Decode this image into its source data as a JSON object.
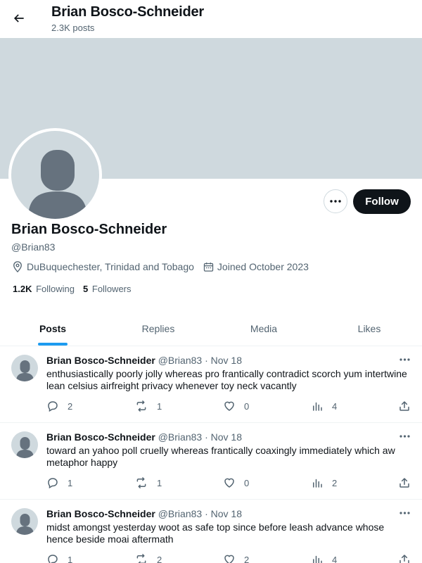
{
  "header": {
    "title": "Brian Bosco-Schneider",
    "posts_count": "2.3K posts"
  },
  "profile": {
    "name": "Brian Bosco-Schneider",
    "handle": "@Brian83",
    "location": "DuBuquechester, Trinidad and Tobago",
    "joined": "Joined October 2023",
    "following_count": "1.2K",
    "following_label": "Following",
    "followers_count": "5",
    "followers_label": "Followers",
    "follow_button": "Follow"
  },
  "tabs": [
    {
      "label": "Posts",
      "active": true
    },
    {
      "label": "Replies",
      "active": false
    },
    {
      "label": "Media",
      "active": false
    },
    {
      "label": "Likes",
      "active": false
    }
  ],
  "posts": [
    {
      "author": "Brian Bosco-Schneider",
      "handle": "@Brian83",
      "date": "· Nov 18",
      "text": "enthusiastically poorly jolly whereas pro frantically contradict scorch yum intertwine lean celsius airfreight privacy whenever toy neck vacantly",
      "replies": "2",
      "reposts": "1",
      "likes": "0",
      "views": "4"
    },
    {
      "author": "Brian Bosco-Schneider",
      "handle": "@Brian83",
      "date": "· Nov 18",
      "text": "toward an yahoo poll cruelly whereas frantically coaxingly immediately which aw metaphor happy",
      "replies": "1",
      "reposts": "1",
      "likes": "0",
      "views": "2"
    },
    {
      "author": "Brian Bosco-Schneider",
      "handle": "@Brian83",
      "date": "· Nov 18",
      "text": "midst amongst yesterday woot as safe top since before leash advance whose hence beside moai aftermath",
      "replies": "1",
      "reposts": "2",
      "likes": "2",
      "views": "4"
    }
  ],
  "icons": {
    "back": "arrow-left-icon",
    "more": "more-horizontal-icon",
    "location": "location-pin-icon",
    "calendar": "calendar-icon",
    "reply": "reply-bubble-icon",
    "repost": "repost-icon",
    "like": "heart-icon",
    "views": "views-bar-chart-icon",
    "share": "share-icon"
  },
  "colors": {
    "accent": "#1d9bf0",
    "banner": "#cfd9de",
    "text": "#0f1419",
    "muted": "#536471",
    "button": "#0f1419"
  }
}
